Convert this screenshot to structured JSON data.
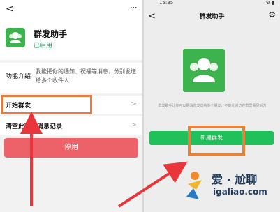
{
  "left": {
    "back_icon": "chevron-left-icon",
    "more_icon": "more-dots-icon",
    "app": {
      "name": "群发助手",
      "status": "已启用",
      "icon": "group-people-icon",
      "color": "#3cb34d"
    },
    "intro": {
      "label": "功能介绍",
      "text": "我能把你的通知、祝福等消息，分别发送给多个收件人"
    },
    "items": [
      {
        "label": "开始群发"
      },
      {
        "label": "清空此功能消息记录"
      }
    ],
    "stop_button": "停用"
  },
  "right": {
    "status_time": "15:35",
    "status_icons": "⚙ ▮",
    "title": "群发助手",
    "back_icon": "chevron-left-icon",
    "settings_icon": "gear-icon",
    "description": "群发助手让你可以把消息发送给多个朋友，不能让对方在群里看见对方",
    "new_button": "新建群发"
  },
  "watermark": {
    "name": "爱 · 尬聊",
    "url": "igaliao.com"
  },
  "colors": {
    "accent_green": "#20c05b",
    "highlight": "#e87a3e",
    "arrow": "#e8363a",
    "stop": "#ec6268"
  }
}
